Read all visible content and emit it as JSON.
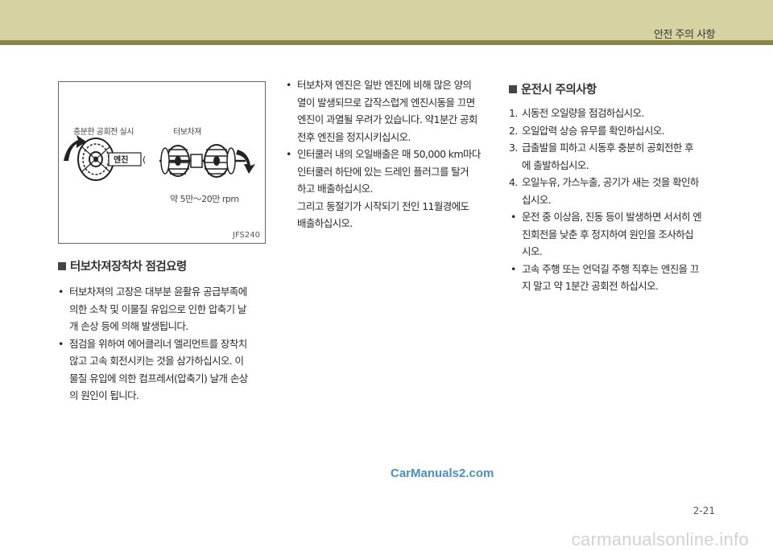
{
  "header": {
    "title": "안전 주의 사항"
  },
  "figure": {
    "label_left": "충분한 공회전 실시",
    "label_right": "터보차져",
    "engine_label": "엔진",
    "rpm_label": "약 5만～20만 rpm",
    "code": "JFS240"
  },
  "left_section": {
    "title": "터보차져장착차 점검요령",
    "items": [
      [
        "터보차져의 고장은 대부분 윤활유 공급부족에",
        "의한 소착 및 이물질 유입으로 인한 압축기 날",
        "개 손상 등에 의해 발생됩니다."
      ],
      [
        "점검을 위하여 에어클리너 엘리먼트를 장착치",
        "않고 고속 회전시키는 것을 삼가하십시오. 이",
        "물질 유입에 의한 컴프레서(압축기) 날개 손상",
        "의 원인이 됩니다."
      ]
    ]
  },
  "middle_section": {
    "items": [
      [
        "터보차져 엔진은 일반 엔진에 비해 많은 양의",
        "열이 발생되므로 갑작스럽게 엔진시동을 끄면",
        "엔진이 과열될 우려가 있습니다. 약1분간 공회",
        "전후 엔진을 정지시키십시오."
      ],
      [
        "인터쿨러 내의 오일배출은 매 50,000 km마다",
        "인터쿨러 하단에 있는 드레인 플러그를 탈거",
        "하고 배출하십시오.",
        "그리고 동절기가 시작되기 전인 11월경에도",
        "배출하십시오."
      ]
    ]
  },
  "right_section": {
    "title": "운전시 주의사항",
    "numbered": [
      {
        "num": "1.",
        "lines": [
          "시동전 오일량을 점검하십시오."
        ]
      },
      {
        "num": "2.",
        "lines": [
          "오일압력 상승 유무를 확인하십시오."
        ]
      },
      {
        "num": "3.",
        "lines": [
          "급출발을 피하고 시동후 충분히 공회전한 후",
          "에 출발하십시오."
        ]
      },
      {
        "num": "4.",
        "lines": [
          "오일누유, 가스누출, 공기가 새는 것을 확인하",
          "십시오."
        ]
      }
    ],
    "bullets": [
      [
        "운전 중 이상음, 진동 등이 발생하면 서서히 엔",
        "진회전을 낮춘 후 정지하여 원인을 조사하십",
        "시오."
      ],
      [
        "고속 주행 또는 언덕길 주행 직후는 엔진을 끄",
        "지 말고 약 1분간 공회전 하십시오."
      ]
    ]
  },
  "watermark": "CarManuals2.com",
  "page_number": "2-21",
  "footer_watermark": "carmanualsonline.info"
}
